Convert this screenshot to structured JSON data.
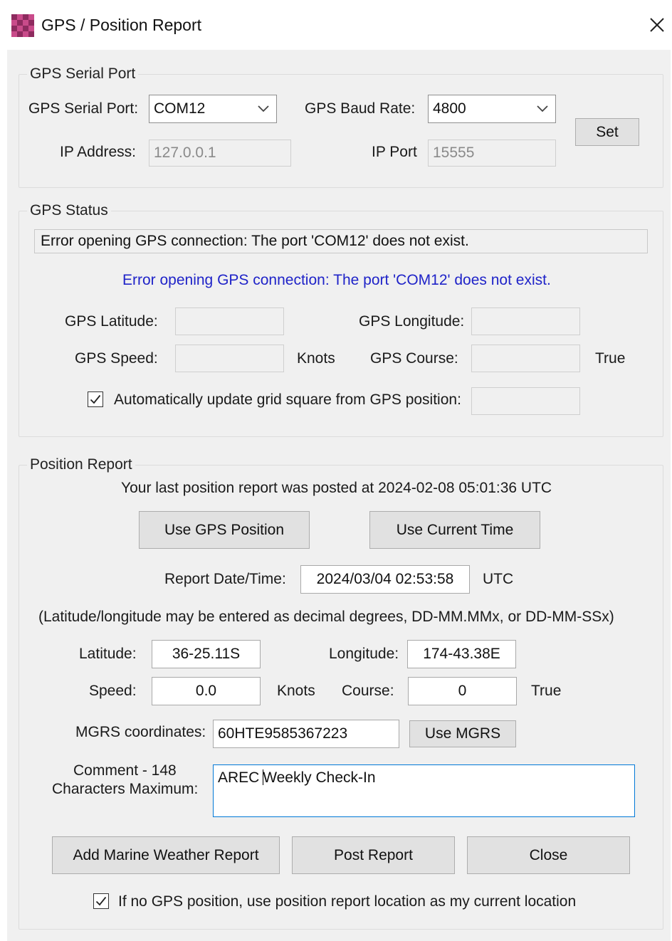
{
  "window": {
    "title": "GPS / Position Report"
  },
  "serial_group": {
    "legend": "GPS Serial Port",
    "serial_port_label": "GPS Serial Port:",
    "serial_port_value": "COM12",
    "baud_rate_label": "GPS Baud Rate:",
    "baud_rate_value": "4800",
    "set_button": "Set",
    "ip_address_label": "IP Address:",
    "ip_address_value": "127.0.0.1",
    "ip_port_label": "IP Port",
    "ip_port_value": "15555"
  },
  "status_group": {
    "legend": "GPS Status",
    "status_box_text": "Error opening GPS connection: The port 'COM12' does not exist.",
    "status_message": "Error opening GPS connection: The port 'COM12' does not exist.",
    "latitude_label": "GPS Latitude:",
    "latitude_value": "",
    "longitude_label": "GPS Longitude:",
    "longitude_value": "",
    "speed_label": "GPS Speed:",
    "speed_value": "",
    "speed_unit": "Knots",
    "course_label": "GPS Course:",
    "course_value": "",
    "course_unit": "True",
    "auto_update_label": "Automatically update grid square from GPS position:",
    "auto_update_checked": true,
    "grid_square_value": ""
  },
  "report_group": {
    "legend": "Position Report",
    "last_report_text": "Your last position report was posted at 2024-02-08 05:01:36 UTC",
    "use_gps_button": "Use GPS Position",
    "use_time_button": "Use Current Time",
    "datetime_label": "Report Date/Time:",
    "datetime_value": "2024/03/04 02:53:58",
    "datetime_unit": "UTC",
    "format_hint": "(Latitude/longitude may be entered as decimal degrees, DD-MM.MMx, or DD-MM-SSx)",
    "latitude_label": "Latitude:",
    "latitude_value": "36-25.11S",
    "longitude_label": "Longitude:",
    "longitude_value": "174-43.38E",
    "speed_label": "Speed:",
    "speed_value": "0.0",
    "speed_unit": "Knots",
    "course_label": "Course:",
    "course_value": "0",
    "course_unit": "True",
    "mgrs_label": "MGRS coordinates:",
    "mgrs_value": "60HTE9585367223",
    "use_mgrs_button": "Use MGRS",
    "comment_label_line1": "Comment - 148",
    "comment_label_line2": "Characters Maximum:",
    "comment_before_caret": "AREC ",
    "comment_after_caret": "Weekly Check-In",
    "marine_button": "Add Marine Weather Report",
    "post_button": "Post Report",
    "close_button": "Close",
    "fallback_label": "If no GPS position, use position report location as my current location",
    "fallback_checked": true
  },
  "icons": {
    "app": "checkered-app-icon",
    "close": "close-icon",
    "dropdown": "chevron-down-icon",
    "check": "checkmark-icon"
  },
  "colors": {
    "window_bg": "#f0f0f0",
    "error_text": "#1f23c8",
    "focus_border": "#0078d7",
    "button_bg": "#e1e1e1"
  }
}
